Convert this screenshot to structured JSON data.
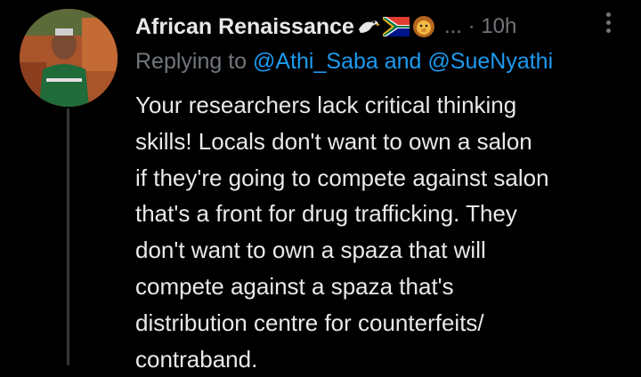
{
  "tweet": {
    "display_name": "African Renaissance",
    "badges": [
      "eagle-emoji",
      "south-africa-flag-emoji",
      "lion-emoji"
    ],
    "truncation": "...",
    "separator": "·",
    "time": "10h",
    "replying_prefix": "Replying to",
    "mention_1": "@Athi_Saba",
    "mention_joiner": "and",
    "mention_2": "@SueNyathi",
    "body_lines": [
      "Your researchers lack critical thinking",
      "skills! Locals don't want to own a salon",
      "if they're going to compete against salon",
      "that's a front for drug trafficking. They",
      "don't want to own a spaza that will",
      "compete against a spaza that's",
      "distribution centre for counterfeits/",
      "contraband."
    ]
  },
  "colors": {
    "background": "#000000",
    "text": "#e7e9ea",
    "muted": "#71767b",
    "link": "#1d9bf0",
    "thread_line": "#333639"
  }
}
